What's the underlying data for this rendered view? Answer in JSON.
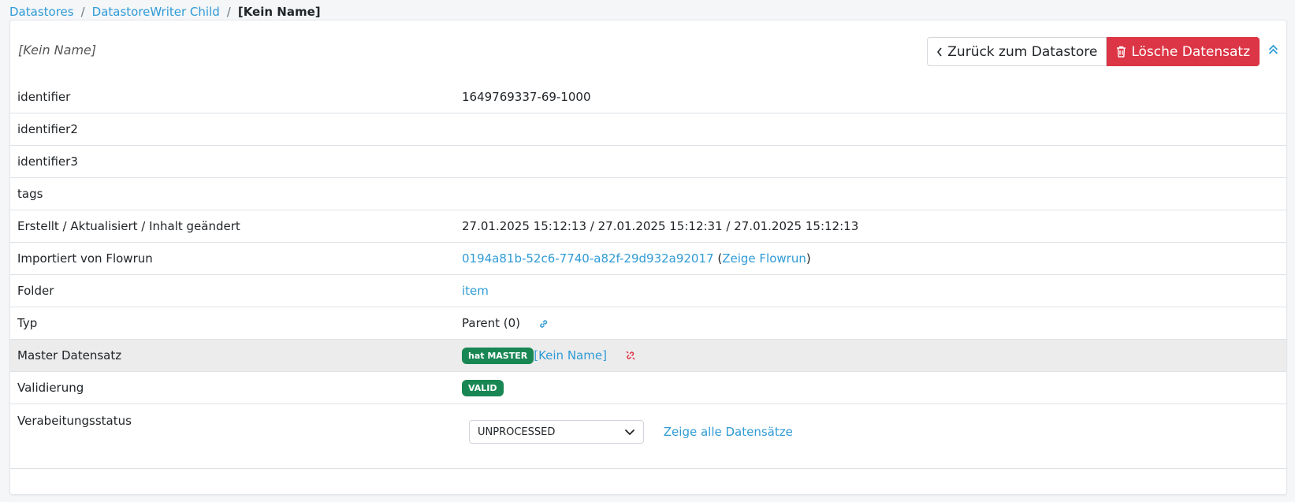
{
  "breadcrumb": {
    "items": [
      "Datastores",
      "DatastoreWriter Child"
    ],
    "separator": "/",
    "current": "[Kein Name]"
  },
  "header": {
    "title": "[Kein Name]",
    "back_label": "Zurück zum Datastore",
    "delete_label": "Lösche Datensatz"
  },
  "rows": {
    "identifier": {
      "label": "identifier",
      "value": "1649769337-69-1000"
    },
    "identifier2": {
      "label": "identifier2",
      "value": ""
    },
    "identifier3": {
      "label": "identifier3",
      "value": ""
    },
    "tags": {
      "label": "tags",
      "value": ""
    },
    "timestamps": {
      "label": "Erstellt / Aktualisiert / Inhalt geändert",
      "value": "27.01.2025 15:12:13 / 27.01.2025 15:12:31 / 27.01.2025 15:12:13"
    },
    "flowrun": {
      "label": "Importiert von Flowrun",
      "id": "0194a81b-52c6-7740-a82f-29d932a92017",
      "open": "(",
      "link": "Zeige Flowrun",
      "close": ")"
    },
    "folder": {
      "label": "Folder",
      "value": "item"
    },
    "typ": {
      "label": "Typ",
      "value": "Parent (0)"
    },
    "master": {
      "label": "Master Datensatz",
      "badge": "hat MASTER",
      "link": "[Kein Name]"
    },
    "validierung": {
      "label": "Validierung",
      "badge": "VALID"
    },
    "status": {
      "label": "Verabeitungsstatus",
      "selected": "UNPROCESSED",
      "link": "Zeige alle Datensätze"
    }
  },
  "icons": {
    "back": "chevron-left-icon",
    "delete": "trash-icon",
    "collapse": "double-chevron-up-icon",
    "typ_link": "link-icon",
    "master_unlink": "unlink-icon",
    "select": "chevron-down-icon"
  },
  "colors": {
    "link": "#2f9bd6",
    "danger": "#dc3545",
    "success": "#198754",
    "highlight_row": "#ececec"
  }
}
